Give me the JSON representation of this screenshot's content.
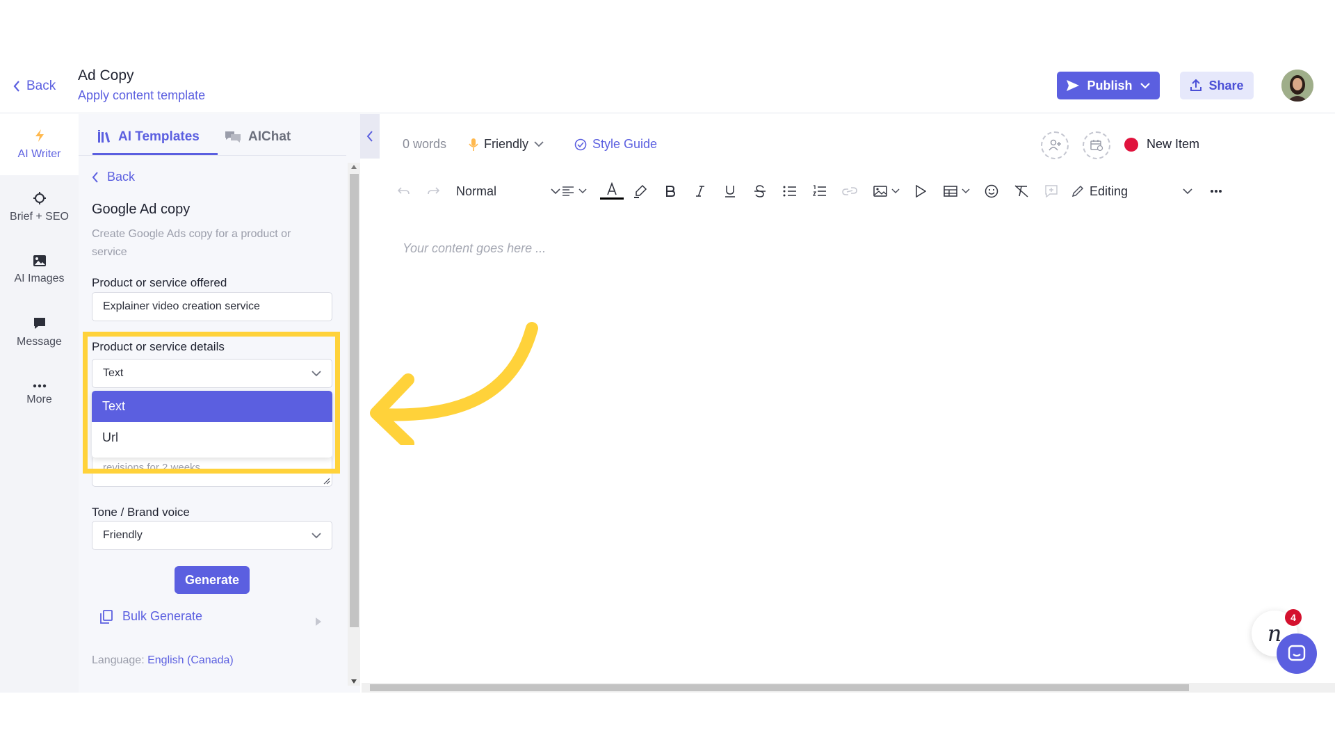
{
  "header": {
    "back_label": "Back",
    "doc_title": "Ad Copy",
    "doc_subtitle": "Apply content template",
    "publish_label": "Publish",
    "share_label": "Share"
  },
  "rail": {
    "items": [
      {
        "label": "AI Writer",
        "icon": "bolt-icon",
        "active": true
      },
      {
        "label": "Brief + SEO",
        "icon": "crosshair-icon"
      },
      {
        "label": "AI Images",
        "icon": "image-icon"
      },
      {
        "label": "Message",
        "icon": "message-icon"
      },
      {
        "label": "More",
        "icon": "more-icon"
      }
    ]
  },
  "panel": {
    "tabs": [
      {
        "label": "AI Templates",
        "icon": "library-icon",
        "active": true
      },
      {
        "label": "AIChat",
        "icon": "chat-bubbles-icon"
      }
    ],
    "back_label": "Back",
    "template_title": "Google Ad copy",
    "template_desc": "Create Google Ads copy for a product or service",
    "fields": {
      "product_label": "Product or service offered",
      "product_value": "Explainer video creation service",
      "details_label": "Product or service details",
      "details_value": "Text",
      "details_options": [
        "Text",
        "Url"
      ],
      "details_text_fragment": "revisions for 2 weeks",
      "tone_label": "Tone / Brand voice",
      "tone_value": "Friendly"
    },
    "generate_label": "Generate",
    "bulk_label": "Bulk Generate",
    "language_label": "Language:",
    "language_value": "English (Canada)"
  },
  "editor": {
    "word_count": "0 words",
    "tone": "Friendly",
    "style_guide": "Style Guide",
    "new_item": "New Item",
    "paragraph_style": "Normal",
    "mode": "Editing",
    "placeholder": "Your content goes here ..."
  },
  "widget": {
    "badge_count": "4",
    "logo_letter": "n"
  },
  "colors": {
    "accent": "#5b5fe0",
    "highlight": "#ffd23a",
    "status_red": "#e0133d"
  }
}
